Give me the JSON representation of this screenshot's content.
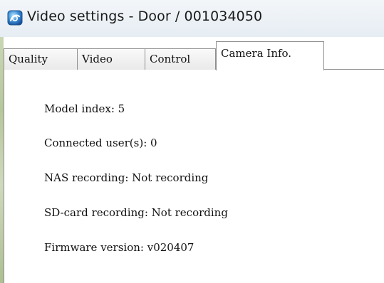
{
  "window": {
    "title": "Video settings - Door / 001034050",
    "icon": "camera-app-icon"
  },
  "tabs": [
    {
      "label": "Quality",
      "active": false
    },
    {
      "label": "Video",
      "active": false
    },
    {
      "label": "Control",
      "active": false
    },
    {
      "label": "Camera Info.",
      "active": true
    }
  ],
  "camera_info": {
    "model_index": "Model index: 5",
    "connected_users": "Connected user(s): 0",
    "nas_recording": "NAS recording: Not recording",
    "sd_card_recording": "SD-card recording: Not recording",
    "firmware_version": "Firmware version: v020407"
  },
  "colors": {
    "titlebar": "#e6edf3",
    "tab_border": "#8e8f8f",
    "text": "#111111"
  }
}
